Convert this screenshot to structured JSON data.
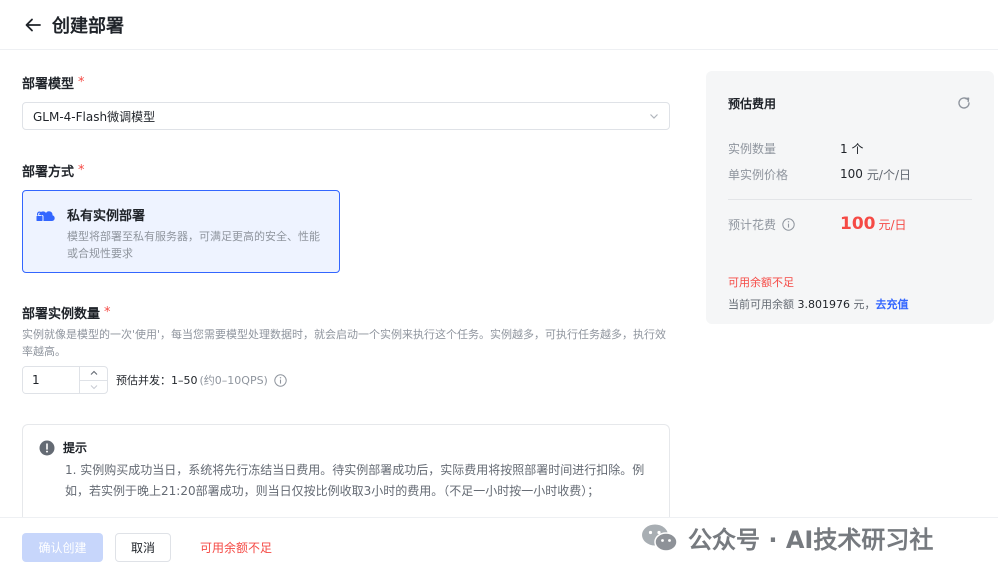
{
  "header": {
    "title": "创建部署"
  },
  "form": {
    "model": {
      "label": "部署模型",
      "required_mark": "*",
      "value": "GLM-4-Flash微调模型"
    },
    "method": {
      "label": "部署方式",
      "required_mark": "*",
      "option_title": "私有实例部署",
      "option_desc": "模型将部署至私有服务器，可满足更高的安全、性能或合规性要求"
    },
    "quantity": {
      "label": "部署实例数量",
      "required_mark": "*",
      "help": "实例就像是模型的一次'使用'，每当您需要模型处理数据时，就会启动一个实例来执行这个任务。实例越多，可执行任务越多，执行效率越高。",
      "value": "1",
      "qps_label": "预估并发：1–50",
      "qps_sub": "(约0–10QPS)"
    },
    "tip": {
      "title": "提示",
      "text": "1. 实例购买成功当日，系统将先行冻结当日费用。待实例部署成功后，实际费用将按照部署时间进行扣除。例如，若实例于晚上21:20部署成功，则当日仅按比例收取3小时的费用。（不足一小时按一小时收费）；"
    }
  },
  "footer": {
    "confirm_label": "确认创建",
    "cancel_label": "取消",
    "warning": "可用余额不足"
  },
  "watermark": "公众号 · AI技术研习社",
  "cost": {
    "title": "预估费用",
    "instance_count_key": "实例数量",
    "instance_count_val": "1 个",
    "unit_price_key": "单实例价格",
    "unit_price_val": "100",
    "unit_price_unit": "元/个/日",
    "estimate_key": "预计花费",
    "estimate_val": "100",
    "estimate_unit": "元/日",
    "insufficient": "可用余额不足",
    "balance_prefix": "当前可用余额",
    "balance_value": "3.801976",
    "balance_suffix": "元，",
    "recharge": "去充值"
  },
  "colors": {
    "primary": "#3366ff",
    "danger": "#f54a45",
    "disabled_primary": "#c7d6fb"
  }
}
